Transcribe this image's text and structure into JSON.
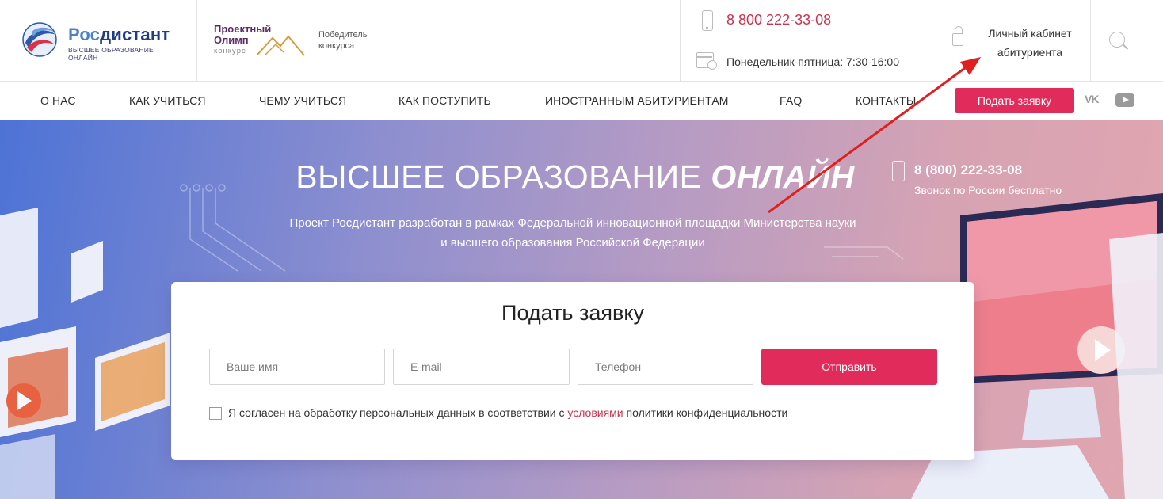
{
  "header": {
    "logo": {
      "brand_part1": "Рос",
      "brand_part2": "дистант",
      "tagline": "ВЫСШЕЕ ОБРАЗОВАНИЕ ОНЛАЙН"
    },
    "olimp": {
      "title_line1": "Проектный",
      "title_line2": "Олимп",
      "konkurs": "конкурс",
      "winner_line1": "Победитель",
      "winner_line2": "конкурса"
    },
    "phone": "8 800 222-33-08",
    "hours": "Понедельник-пятница: 7:30-16:00",
    "cabinet_line1": "Личный кабинет",
    "cabinet_line2": "абитуриента"
  },
  "nav": {
    "items": [
      "О НАС",
      "КАК УЧИТЬСЯ",
      "ЧЕМУ УЧИТЬСЯ",
      "КАК ПОСТУПИТЬ",
      "ИНОСТРАННЫМ АБИТУРИЕНТАМ",
      "FAQ",
      "КОНТАКТЫ"
    ],
    "apply_button": "Подать заявку",
    "vk": "VK"
  },
  "hero": {
    "title_plain": "ВЫСШЕЕ ОБРАЗОВАНИЕ ",
    "title_emph": "ОНЛАЙН",
    "subtitle_line1": "Проект Росдистант разработан в рамках Федеральной инновационной площадки Министерства науки",
    "subtitle_line2": "и высшего образования Российской Федерации",
    "phone": "8 (800) 222-33-08",
    "phone_note": "Звонок по России бесплатно"
  },
  "form": {
    "title": "Подать заявку",
    "name_placeholder": "Ваше имя",
    "email_placeholder": "E-mail",
    "phone_placeholder": "Телефон",
    "submit": "Отправить",
    "agree_before": "Я согласен на обработку персональных данных в соответствии с ",
    "agree_link": "условиями",
    "agree_after": " политики конфиденциальности"
  },
  "colors": {
    "accent": "#e02b5b",
    "brand_blue": "#1f3d8a",
    "annotation_arrow": "#e0201e"
  }
}
